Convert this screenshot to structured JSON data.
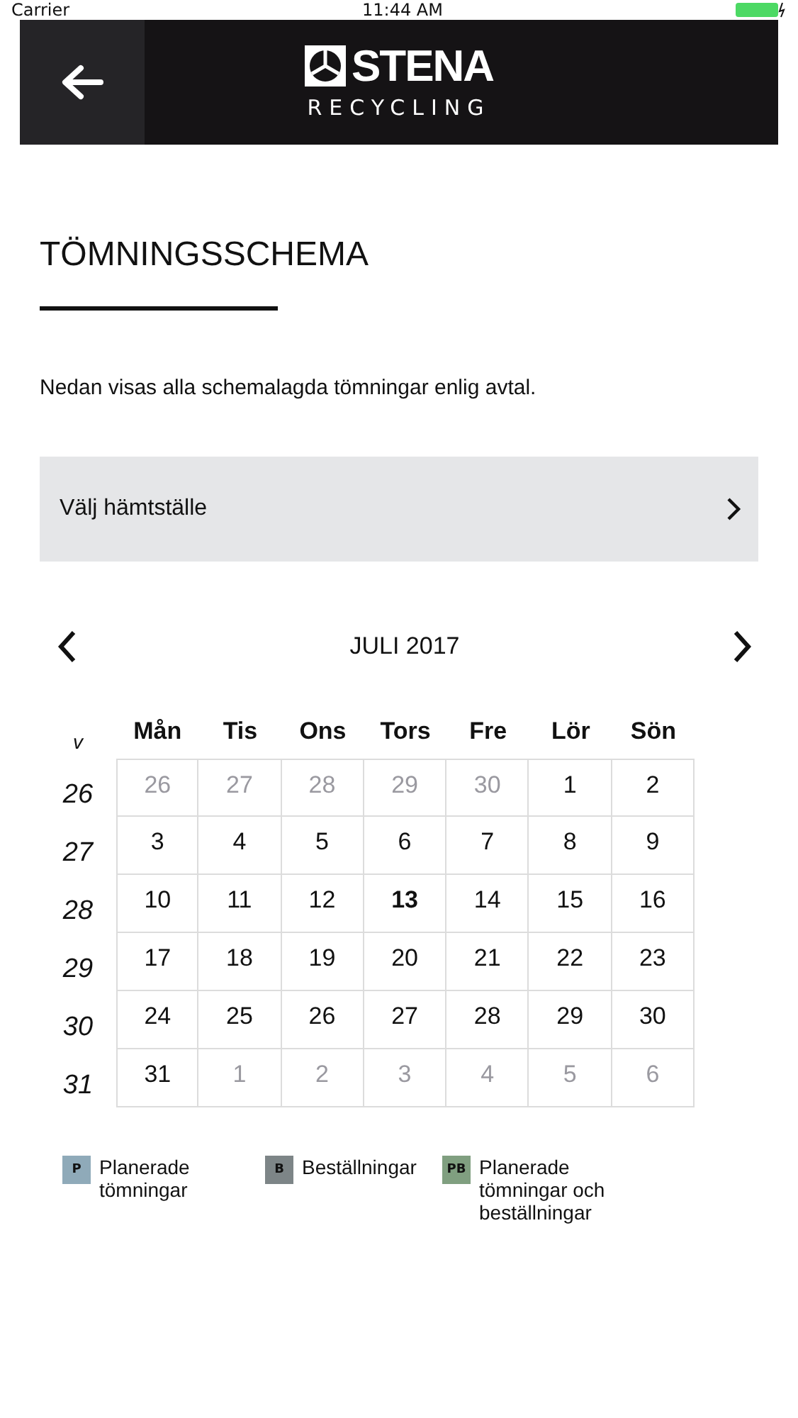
{
  "status_bar": {
    "carrier": "Carrier",
    "time": "11:44 AM"
  },
  "header": {
    "logo_name": "STENA",
    "logo_sub": "RECYCLING"
  },
  "title": "TÖMNINGSSCHEMA",
  "intro": "Nedan visas alla schemalagda tömningar enlig avtal.",
  "picker": {
    "label": "Välj hämtställe"
  },
  "calendar": {
    "month": "JULI 2017",
    "week_heading": "v",
    "weekdays": [
      "Mån",
      "Tis",
      "Ons",
      "Tors",
      "Fre",
      "Lör",
      "Sön"
    ],
    "weeks": [
      {
        "number": "26",
        "days": [
          {
            "label": "26",
            "muted": true,
            "today": false
          },
          {
            "label": "27",
            "muted": true,
            "today": false
          },
          {
            "label": "28",
            "muted": true,
            "today": false
          },
          {
            "label": "29",
            "muted": true,
            "today": false
          },
          {
            "label": "30",
            "muted": true,
            "today": false
          },
          {
            "label": "1",
            "muted": false,
            "today": false
          },
          {
            "label": "2",
            "muted": false,
            "today": false
          }
        ]
      },
      {
        "number": "27",
        "days": [
          {
            "label": "3",
            "muted": false,
            "today": false
          },
          {
            "label": "4",
            "muted": false,
            "today": false
          },
          {
            "label": "5",
            "muted": false,
            "today": false
          },
          {
            "label": "6",
            "muted": false,
            "today": false
          },
          {
            "label": "7",
            "muted": false,
            "today": false
          },
          {
            "label": "8",
            "muted": false,
            "today": false
          },
          {
            "label": "9",
            "muted": false,
            "today": false
          }
        ]
      },
      {
        "number": "28",
        "days": [
          {
            "label": "10",
            "muted": false,
            "today": false
          },
          {
            "label": "11",
            "muted": false,
            "today": false
          },
          {
            "label": "12",
            "muted": false,
            "today": false
          },
          {
            "label": "13",
            "muted": false,
            "today": true
          },
          {
            "label": "14",
            "muted": false,
            "today": false
          },
          {
            "label": "15",
            "muted": false,
            "today": false
          },
          {
            "label": "16",
            "muted": false,
            "today": false
          }
        ]
      },
      {
        "number": "29",
        "days": [
          {
            "label": "17",
            "muted": false,
            "today": false
          },
          {
            "label": "18",
            "muted": false,
            "today": false
          },
          {
            "label": "19",
            "muted": false,
            "today": false
          },
          {
            "label": "20",
            "muted": false,
            "today": false
          },
          {
            "label": "21",
            "muted": false,
            "today": false
          },
          {
            "label": "22",
            "muted": false,
            "today": false
          },
          {
            "label": "23",
            "muted": false,
            "today": false
          }
        ]
      },
      {
        "number": "30",
        "days": [
          {
            "label": "24",
            "muted": false,
            "today": false
          },
          {
            "label": "25",
            "muted": false,
            "today": false
          },
          {
            "label": "26",
            "muted": false,
            "today": false
          },
          {
            "label": "27",
            "muted": false,
            "today": false
          },
          {
            "label": "28",
            "muted": false,
            "today": false
          },
          {
            "label": "29",
            "muted": false,
            "today": false
          },
          {
            "label": "30",
            "muted": false,
            "today": false
          }
        ]
      },
      {
        "number": "31",
        "days": [
          {
            "label": "31",
            "muted": false,
            "today": false
          },
          {
            "label": "1",
            "muted": true,
            "today": false
          },
          {
            "label": "2",
            "muted": true,
            "today": false
          },
          {
            "label": "3",
            "muted": true,
            "today": false
          },
          {
            "label": "4",
            "muted": true,
            "today": false
          },
          {
            "label": "5",
            "muted": true,
            "today": false
          },
          {
            "label": "6",
            "muted": true,
            "today": false
          }
        ]
      }
    ]
  },
  "legend": [
    {
      "code": "P",
      "label": "Planerade tömningar",
      "color": "#8faab9"
    },
    {
      "code": "B",
      "label": "Beställningar",
      "color": "#7d8587"
    },
    {
      "code": "PB",
      "label": "Planerade tömningar och beställningar",
      "color": "#809f80"
    }
  ]
}
